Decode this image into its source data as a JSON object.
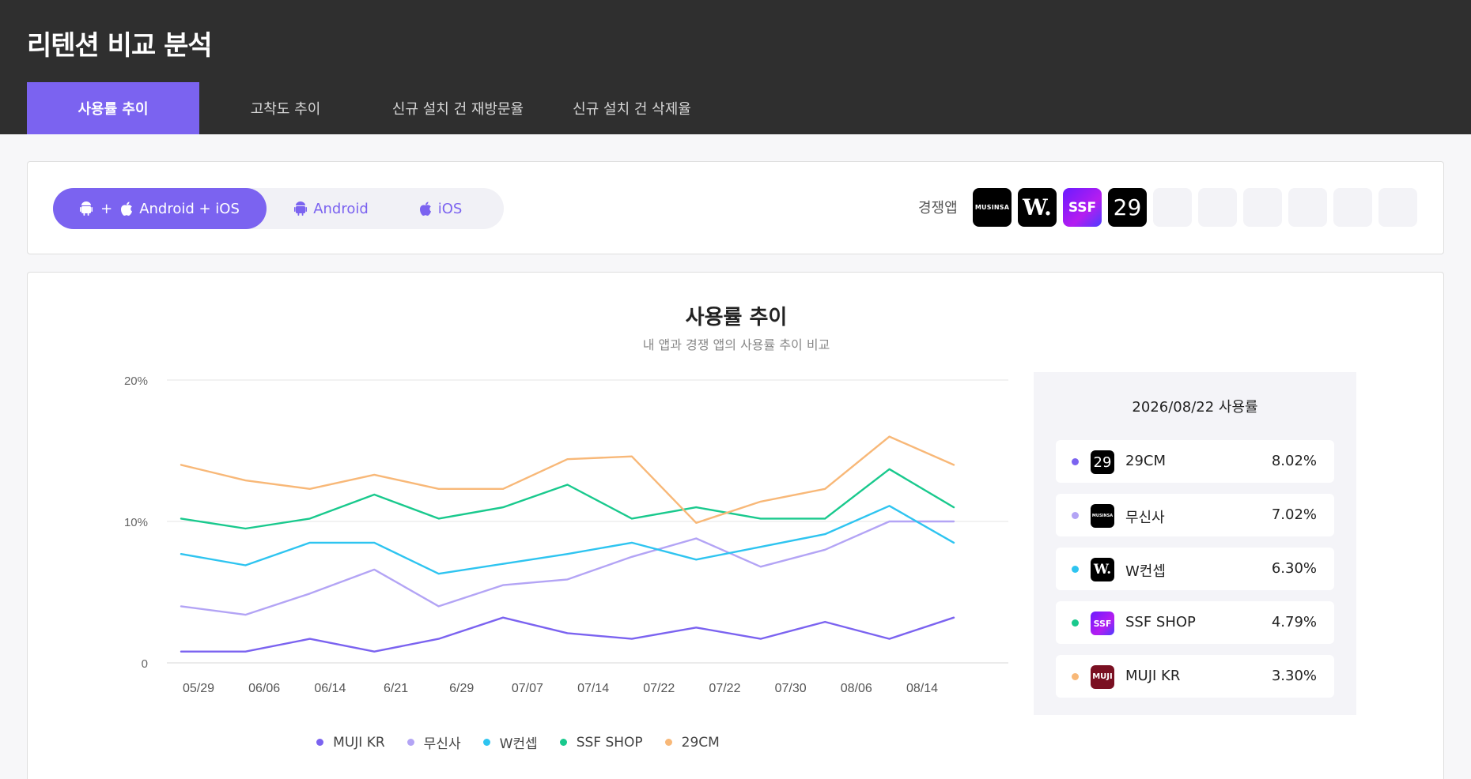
{
  "header": {
    "title": "리텐션 비교 분석"
  },
  "tabs": [
    {
      "label": "사용률 추이",
      "active": true
    },
    {
      "label": "고착도 추이",
      "active": false
    },
    {
      "label": "신규 설치 건 재방문율",
      "active": false
    },
    {
      "label": "신규 설치 건 삭제율",
      "active": false
    }
  ],
  "platform": {
    "options": [
      {
        "label": "Android + iOS",
        "plus": "+",
        "icons": [
          "android-icon",
          "apple-icon"
        ],
        "active": true
      },
      {
        "label": "Android",
        "icons": [
          "android-icon"
        ],
        "active": false
      },
      {
        "label": "iOS",
        "icons": [
          "apple-icon"
        ],
        "active": false
      }
    ]
  },
  "competitors": {
    "label": "경쟁앱",
    "apps": [
      {
        "name": "무신사",
        "logo_text": "MUSINSA"
      },
      {
        "name": "W컨셉",
        "logo_text": "W."
      },
      {
        "name": "SSF SHOP",
        "logo_text": "SSF"
      },
      {
        "name": "29CM",
        "logo_text": "29"
      }
    ],
    "empty_slots": 6
  },
  "chart": {
    "title": "사용률 추이",
    "subtitle": "내 앱과 경쟁 앱의 사용률 추이 비교"
  },
  "chart_data": {
    "type": "line",
    "title": "사용률 추이",
    "subtitle": "내 앱과 경쟁 앱의 사용률 추이 비교",
    "x_tick_labels": [
      "05/29",
      "06/06",
      "06/14",
      "6/21",
      "6/29",
      "07/07",
      "07/14",
      "07/22",
      "07/22",
      "07/30",
      "08/06",
      "08/14"
    ],
    "y_ticks": [
      "0",
      "10%",
      "20%"
    ],
    "ylim": [
      0,
      20
    ],
    "grid": true,
    "legend_position": "bottom",
    "series": [
      {
        "name": "MUJI KR",
        "color": "#7b63f0",
        "values": [
          0.8,
          0.8,
          1.7,
          0.8,
          1.7,
          3.2,
          2.1,
          1.7,
          2.5,
          1.7,
          2.9,
          1.7,
          3.2
        ]
      },
      {
        "name": "무신사",
        "color": "#b3a4f5",
        "values": [
          4.0,
          3.4,
          4.9,
          6.6,
          4.0,
          5.5,
          5.9,
          7.5,
          8.8,
          6.8,
          8.0,
          10.0,
          10.0
        ]
      },
      {
        "name": "W컨셉",
        "color": "#2ec4f0",
        "values": [
          7.7,
          6.9,
          8.5,
          8.5,
          6.3,
          7.0,
          7.7,
          8.5,
          7.3,
          8.2,
          9.1,
          11.1,
          8.5
        ]
      },
      {
        "name": "SSF SHOP",
        "color": "#19c98d",
        "values": [
          10.2,
          9.5,
          10.2,
          11.9,
          10.2,
          11.0,
          12.6,
          10.2,
          11.0,
          10.2,
          10.2,
          13.7,
          11.0
        ]
      },
      {
        "name": "29CM",
        "color": "#f8b878",
        "values": [
          14.0,
          12.9,
          12.3,
          13.3,
          12.3,
          12.3,
          14.4,
          14.6,
          9.9,
          11.4,
          12.3,
          16.0,
          14.0
        ]
      }
    ]
  },
  "ranking": {
    "title": "2026/08/22 사용률",
    "items": [
      {
        "name": "29CM",
        "value": "8.02%",
        "color": "#7b63f0",
        "icon": "29cm-logo-icon",
        "logo_text": "29"
      },
      {
        "name": "무신사",
        "value": "7.02%",
        "color": "#b3a4f5",
        "icon": "musinsa-logo-icon",
        "logo_text": "MUSINSA"
      },
      {
        "name": "W컨셉",
        "value": "6.30%",
        "color": "#2ec4f0",
        "icon": "wconcept-logo-icon",
        "logo_text": "W."
      },
      {
        "name": "SSF SHOP",
        "value": "4.79%",
        "color": "#19c98d",
        "icon": "ssf-logo-icon",
        "logo_text": "SSF"
      },
      {
        "name": "MUJI KR",
        "value": "3.30%",
        "color": "#f8b878",
        "icon": "muji-logo-icon",
        "logo_text": "MUJI"
      }
    ]
  }
}
